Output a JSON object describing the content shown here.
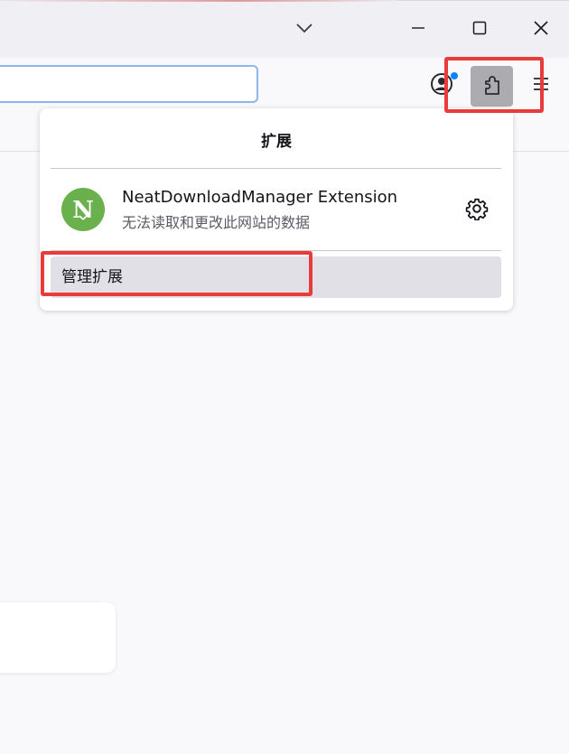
{
  "window": {
    "dropdown_icon": "chevron-down-icon",
    "minimize_icon": "minimize-icon",
    "maximize_icon": "maximize-icon",
    "close_icon": "close-icon"
  },
  "toolbar": {
    "url_value": "",
    "account_icon": "account-icon",
    "extensions_icon": "puzzle-piece-icon",
    "menu_icon": "hamburger-menu-icon"
  },
  "extensions_panel": {
    "title": "扩展",
    "extensions": [
      {
        "name": "NeatDownloadManager Extension",
        "status": "无法读取和更改此网站的数据",
        "icon": "ndm-logo-icon",
        "settings_icon": "gear-icon",
        "logo_letter": "N"
      }
    ],
    "manage_label": "管理扩展"
  },
  "colors": {
    "highlight": "#ea3b3b",
    "accent_blue": "#0a84ff",
    "ext_logo_green": "#6ab04c",
    "active_button": "#acacb0"
  }
}
